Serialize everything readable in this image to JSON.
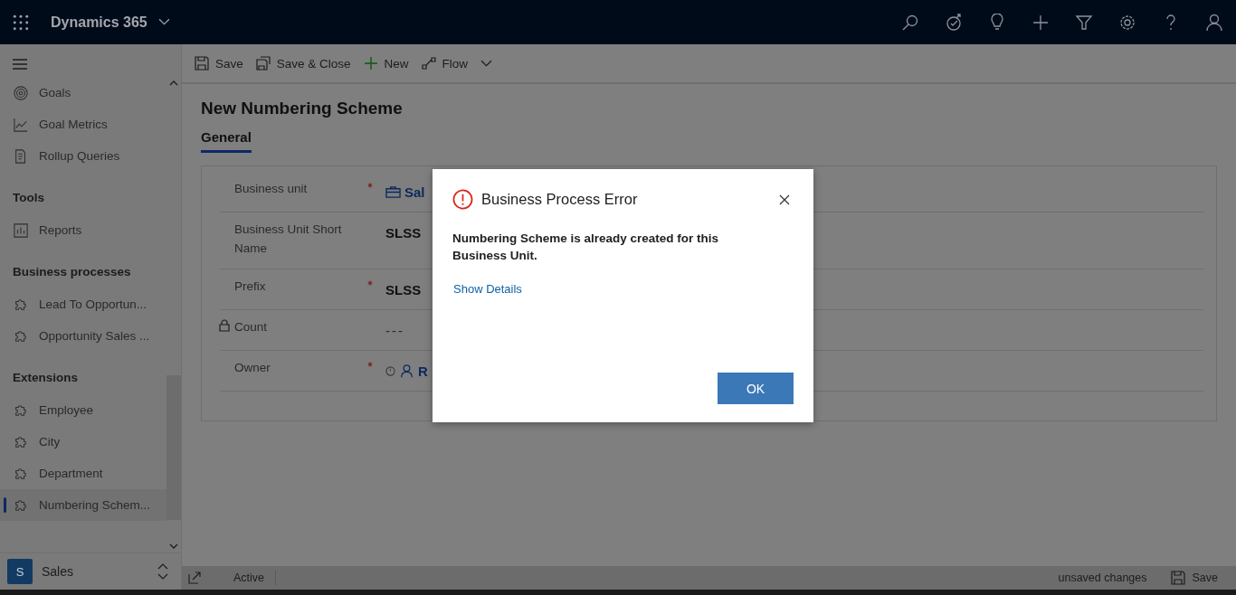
{
  "header": {
    "app_name": "Dynamics 365"
  },
  "command_bar": [
    {
      "label": "Save"
    },
    {
      "label": "Save & Close"
    },
    {
      "label": "New"
    },
    {
      "label": "Flow"
    }
  ],
  "sidebar": {
    "groups": [
      {
        "items": [
          {
            "label": "Goals",
            "selected": false
          },
          {
            "label": "Goal Metrics",
            "selected": false
          },
          {
            "label": "Rollup Queries",
            "selected": false
          }
        ]
      },
      {
        "title": "Tools",
        "items": [
          {
            "label": "Reports",
            "selected": false
          }
        ]
      },
      {
        "title": "Business processes",
        "items": [
          {
            "label": "Lead To Opportun...",
            "selected": false
          },
          {
            "label": "Opportunity Sales ...",
            "selected": false
          }
        ]
      },
      {
        "title": "Extensions",
        "items": [
          {
            "label": "Employee",
            "selected": false
          },
          {
            "label": "City",
            "selected": false
          },
          {
            "label": "Department",
            "selected": false
          },
          {
            "label": "Numbering Schem...",
            "selected": true
          }
        ]
      }
    ],
    "area": {
      "initial": "S",
      "label": "Sales"
    }
  },
  "form": {
    "title": "New Numbering Scheme",
    "tabs": [
      {
        "label": "General",
        "selected": true
      }
    ],
    "fields": [
      {
        "label": "Business unit",
        "required": true,
        "locked": false,
        "kind": "unit-lookup",
        "value": "Sal"
      },
      {
        "label": "Business Unit Short Name",
        "required": false,
        "locked": false,
        "kind": "text",
        "value": "SLSS"
      },
      {
        "label": "Prefix",
        "required": true,
        "locked": false,
        "kind": "text",
        "value": "SLSS"
      },
      {
        "label": "Count",
        "required": false,
        "locked": true,
        "kind": "empty",
        "value": "---"
      },
      {
        "label": "Owner",
        "required": true,
        "locked": false,
        "kind": "user-lookup",
        "value": "R"
      }
    ]
  },
  "status_bar": {
    "status": "Active",
    "unsaved": "unsaved changes",
    "save": "Save"
  },
  "dialog": {
    "title": "Business Process Error",
    "message": "Numbering Scheme is already created for this Business Unit.",
    "link": "Show Details",
    "button": "OK"
  }
}
